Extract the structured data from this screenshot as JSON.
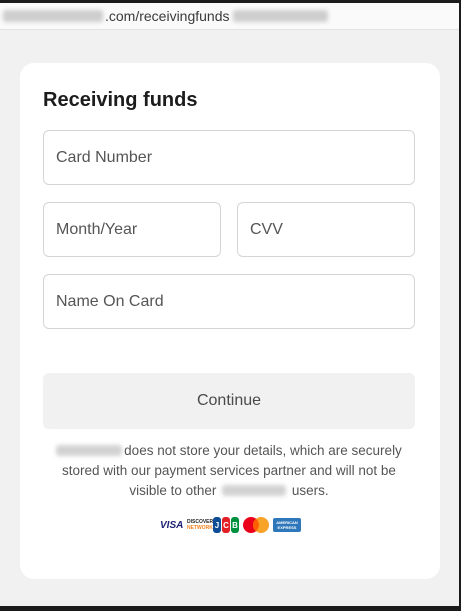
{
  "browser": {
    "url_path": ".com/receivingfunds"
  },
  "form": {
    "title": "Receiving funds",
    "card_number_placeholder": "Card Number",
    "month_year_placeholder": "Month/Year",
    "cvv_placeholder": "CVV",
    "name_on_card_placeholder": "Name On Card",
    "continue_label": "Continue"
  },
  "disclaimer": {
    "part1": "does not store your details, which are securely stored with our payment services partner and will not be visible to other",
    "part2": "users."
  },
  "payment_logos": {
    "visa": "VISA",
    "discover": "DISCOVER",
    "discover_sub": "NETWORK",
    "jcb": [
      "J",
      "C",
      "B"
    ],
    "amex_line1": "AMERICAN",
    "amex_line2": "EXPRESS"
  },
  "colors": {
    "page_bg": "#f1f1f1",
    "card_bg": "#ffffff",
    "field_border": "#d5d5d5",
    "button_bg": "#f1f1f1"
  }
}
